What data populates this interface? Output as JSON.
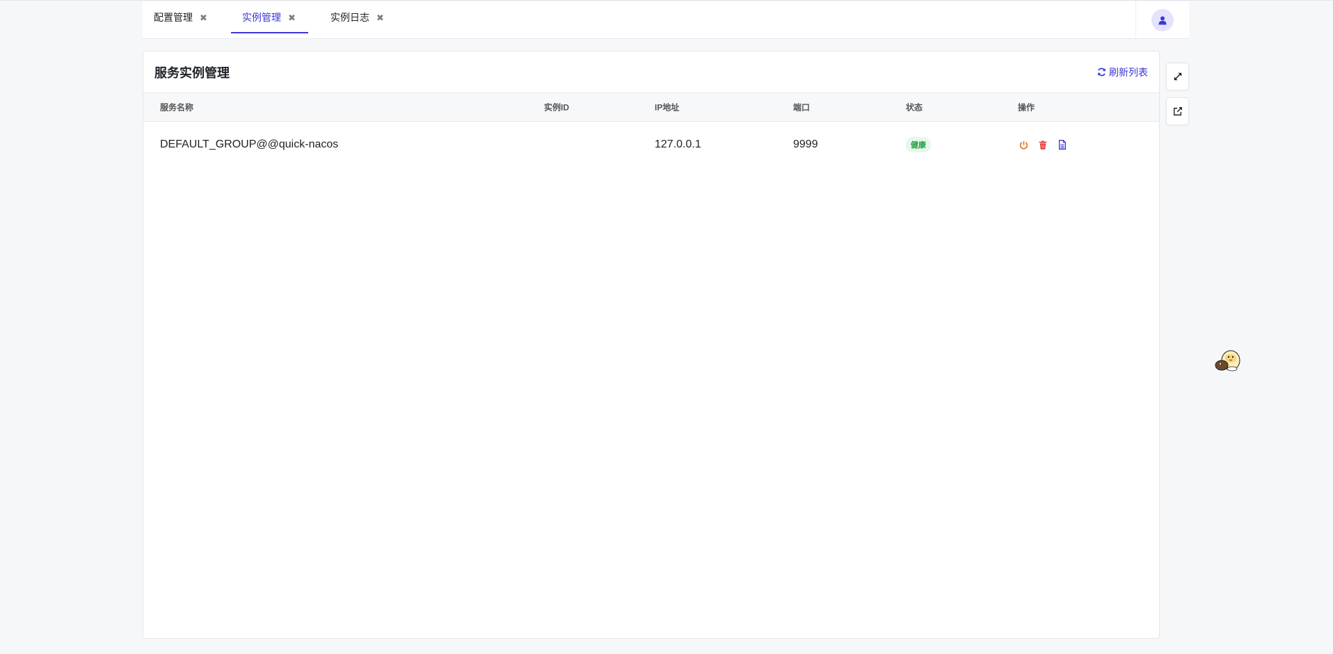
{
  "tabs": [
    {
      "label": "配置管理",
      "active": false
    },
    {
      "label": "实例管理",
      "active": true
    },
    {
      "label": "实例日志",
      "active": false
    }
  ],
  "tab_close_glyph": "✖",
  "panel": {
    "title": "服务实例管理",
    "refresh_label": "刷新列表"
  },
  "table": {
    "columns": {
      "name": "服务名称",
      "id": "实例ID",
      "ip": "IP地址",
      "port": "端口",
      "status": "状态",
      "ops": "操作"
    },
    "rows": [
      {
        "name": "DEFAULT_GROUP@@quick-nacos",
        "id": "",
        "ip": "127.0.0.1",
        "port": "9999",
        "status": "健康"
      }
    ]
  },
  "colors": {
    "accent": "#3b36d8",
    "power": "#e2711d",
    "delete": "#e0302f",
    "log": "#3b36d8",
    "healthy_bg": "#e7f7ea",
    "healthy_text": "#23a145"
  },
  "icons": {
    "avatar": "user-icon",
    "refresh": "refresh-icon",
    "ops": [
      "power-icon",
      "trash-icon",
      "document-icon"
    ],
    "side": [
      "expand-icon",
      "external-link-icon"
    ]
  }
}
